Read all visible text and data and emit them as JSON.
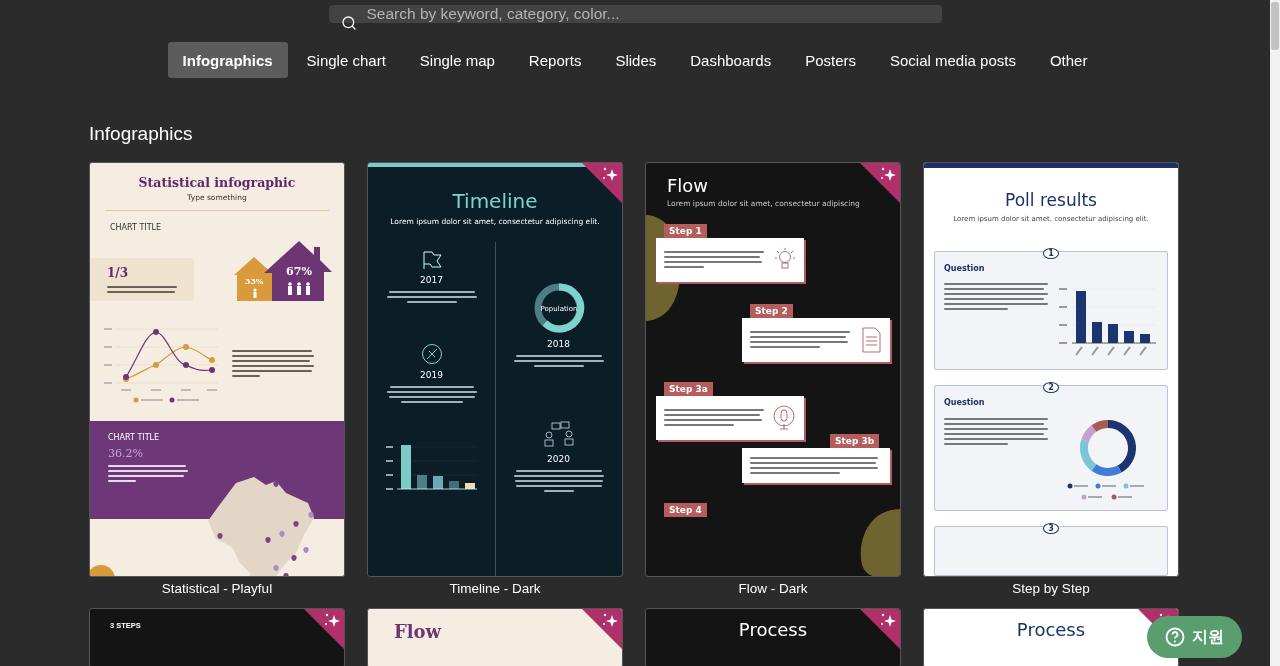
{
  "search": {
    "placeholder": "Search by keyword, category, color..."
  },
  "tabs": [
    {
      "label": "Infographics",
      "selected": true
    },
    {
      "label": "Single chart",
      "selected": false
    },
    {
      "label": "Single map",
      "selected": false
    },
    {
      "label": "Reports",
      "selected": false
    },
    {
      "label": "Slides",
      "selected": false
    },
    {
      "label": "Dashboards",
      "selected": false
    },
    {
      "label": "Posters",
      "selected": false
    },
    {
      "label": "Social media posts",
      "selected": false
    },
    {
      "label": "Other",
      "selected": false
    }
  ],
  "section": {
    "title": "Infographics"
  },
  "templates": [
    {
      "kind": "statistical",
      "name": "Statistical - Playful",
      "premium": false,
      "title": "Statistical infographic",
      "subtitle": "Type something",
      "chart_title": "CHART TITLE",
      "stat": "1/3",
      "house_small": "33%",
      "house_large": "67%",
      "band_title": "CHART TITLE",
      "band_stat": "36.2%"
    },
    {
      "kind": "timeline",
      "name": "Timeline - Dark",
      "premium": true,
      "title": "Timeline",
      "subtitle": "Lorem ipsum dolor sit amet, consectetur adipiscing elit.",
      "events": [
        {
          "year": "2017"
        },
        {
          "year": "2018",
          "label": "Population"
        },
        {
          "year": "2019"
        },
        {
          "year": "2020"
        }
      ]
    },
    {
      "kind": "flow",
      "name": "Flow - Dark",
      "premium": true,
      "title": "Flow",
      "subtitle": "Lorem ipsum dolor sit amet, consectetur adipiscing",
      "steps": [
        {
          "label": "Step 1"
        },
        {
          "label": "Step 2"
        },
        {
          "label": "Step 3a"
        },
        {
          "label": "Step 3b"
        },
        {
          "label": "Step 4"
        }
      ]
    },
    {
      "kind": "poll",
      "name": "Step by Step",
      "premium": false,
      "title": "Poll results",
      "subtitle": "Lorem ipsum dolor sit amet, consectetur adipiscing elit.",
      "questions": [
        {
          "number": "1",
          "title": "Question"
        },
        {
          "number": "2",
          "title": "Question"
        },
        {
          "number": "3"
        }
      ]
    },
    {
      "kind": "steps",
      "premium": true,
      "label": "3 STEPS"
    },
    {
      "kind": "flow-light",
      "premium": true,
      "title": "Flow"
    },
    {
      "kind": "process-dark",
      "premium": true,
      "title": "Process"
    },
    {
      "kind": "process-light",
      "premium": true,
      "title": "Process"
    }
  ],
  "help_button": {
    "label": "지원"
  }
}
